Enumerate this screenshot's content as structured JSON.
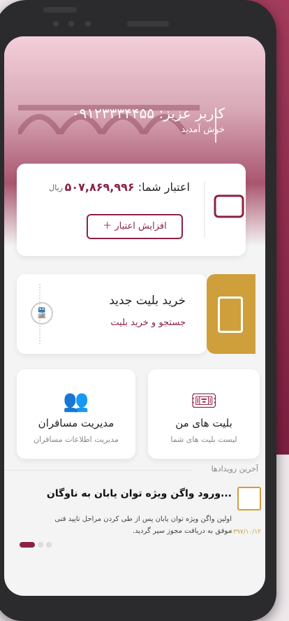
{
  "header": {
    "greeting": "کاربر عزیز: ۰۹۱۲۳۳۳۴۴۵۵",
    "welcome": "خوش آمدید"
  },
  "balance": {
    "label": "اعتبار شما:",
    "amount": "۵۰۷,۸۶۹,۹۹۶",
    "unit": "ریال",
    "increase_button": "افزایش اعتبار"
  },
  "buy_ticket": {
    "title": "خرید بلیت جدید",
    "subtitle": "جستجو و خرید بلیت"
  },
  "tiles": [
    {
      "title": "مدیریت مسافران",
      "subtitle": "مدیریت اطلاعات مسافران",
      "icon": "passengers-icon"
    },
    {
      "title": "بلیت های من",
      "subtitle": "لیست بلیت های شما",
      "icon": "tickets-icon"
    }
  ],
  "events": {
    "label": "آخرین رویدادها",
    "title": "ورود واگن ویژه توان یابان به ناوگان...",
    "body": "اولین واگن ویژه توان یابان پس از طی کردن مراحل تایید فنی موفق به دریافت مجوز سیر گردید.",
    "date": "۱۳۹۷/۱۰/۱۲"
  },
  "colors": {
    "primary": "#8c2242",
    "gold": "#cf9f3c"
  }
}
